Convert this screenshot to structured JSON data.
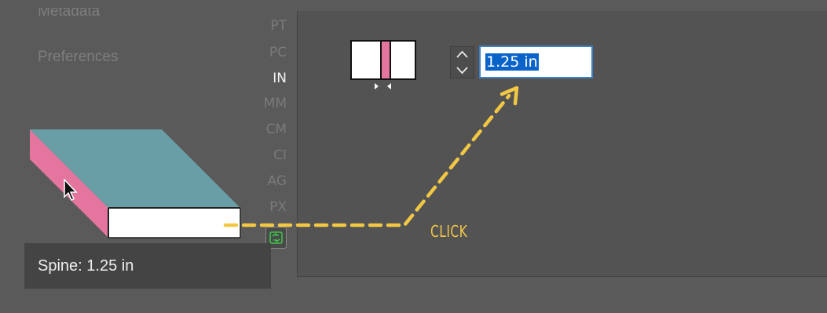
{
  "sidebar": {
    "items": [
      {
        "label": "Metadata"
      },
      {
        "label": "Preferences"
      }
    ]
  },
  "units": {
    "options": [
      "PT",
      "PC",
      "IN",
      "MM",
      "CM",
      "CI",
      "AG",
      "PX"
    ],
    "selected": "IN"
  },
  "spine_field": {
    "value": "1.25 in"
  },
  "tooltip": {
    "text": "Spine: 1.25 in"
  },
  "annotation": {
    "label": "CLICK",
    "color": "#f2c744"
  },
  "colors": {
    "cover_top": "#6a9ea6",
    "spine": "#e4759e",
    "selection": "#0a63c9"
  },
  "icons": {
    "swap": "swap-icon",
    "stepper_up": "chevron-up-icon",
    "stepper_down": "chevron-down-icon",
    "cursor": "pointer-cursor-icon"
  }
}
